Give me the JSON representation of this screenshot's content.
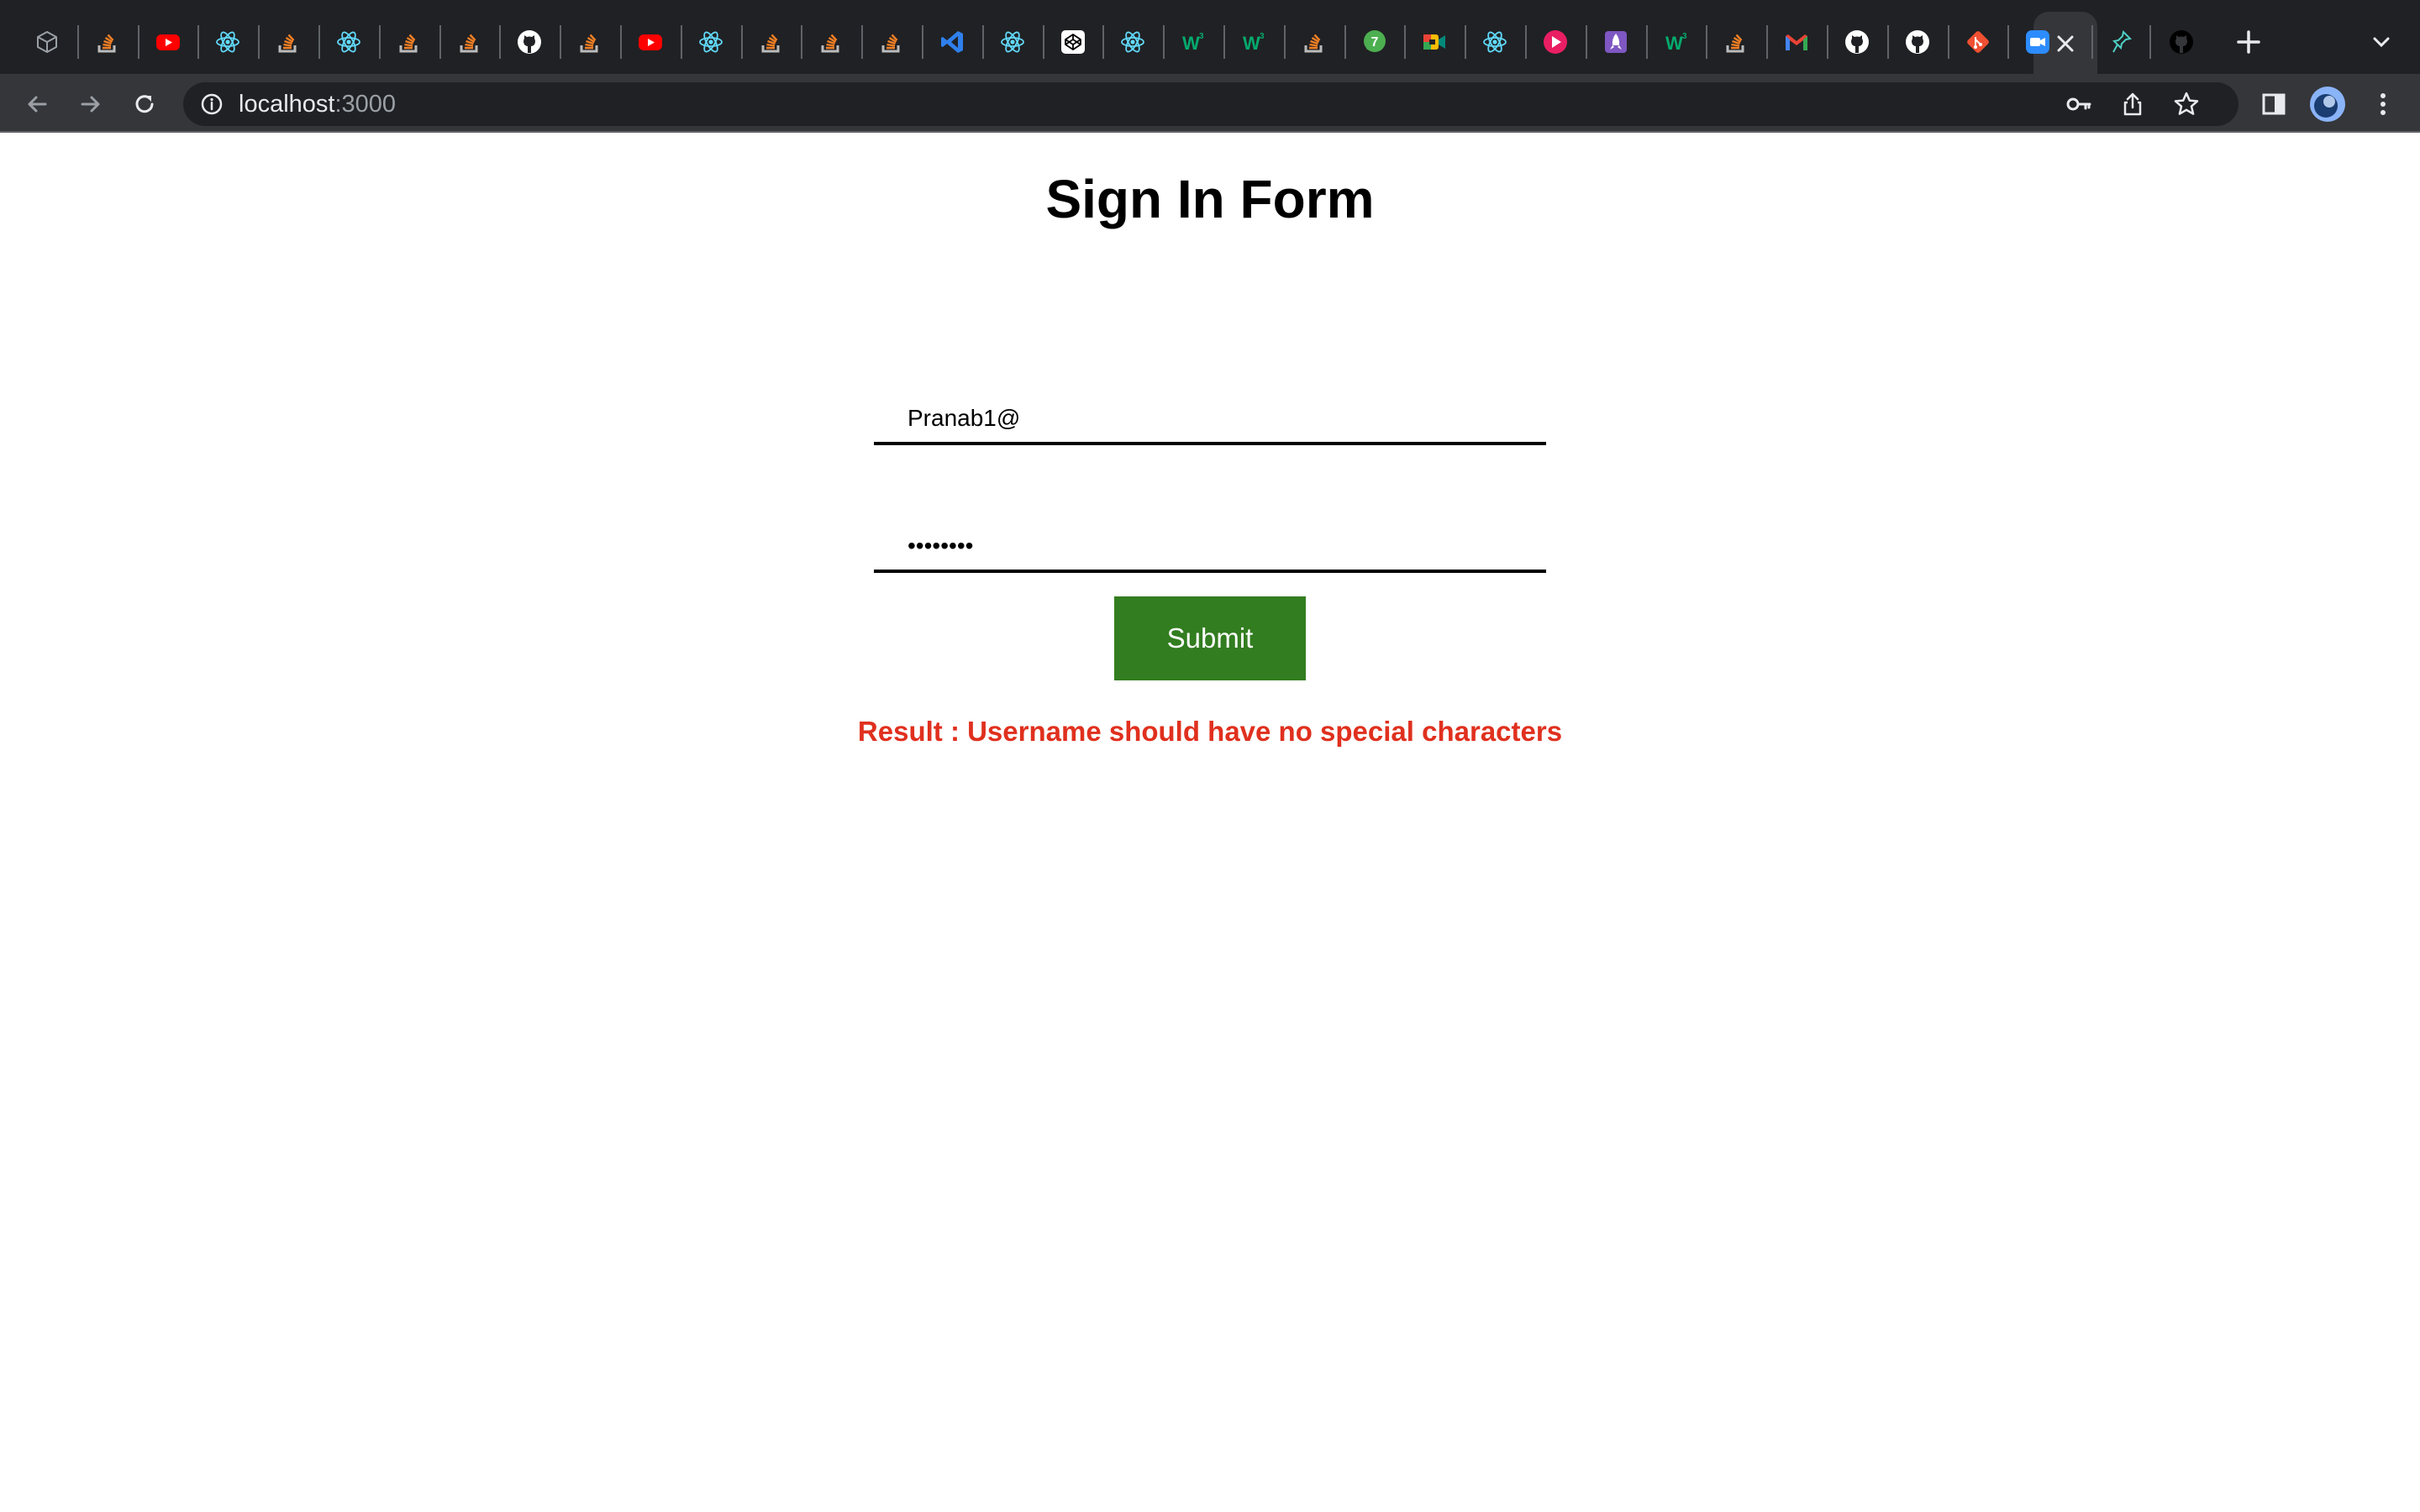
{
  "browser": {
    "tabs": [
      {
        "icon": "cube-icon",
        "color": "#9aa0a6"
      },
      {
        "icon": "stackoverflow-icon",
        "color": "#f48024"
      },
      {
        "icon": "youtube-icon",
        "color": "#ff0000"
      },
      {
        "icon": "react-icon",
        "color": "#61dafb"
      },
      {
        "icon": "stackoverflow-icon",
        "color": "#f48024"
      },
      {
        "icon": "react-icon",
        "color": "#61dafb"
      },
      {
        "icon": "stackoverflow-icon",
        "color": "#f48024"
      },
      {
        "icon": "stackoverflow-icon",
        "color": "#f48024"
      },
      {
        "icon": "github-icon",
        "color": "#ffffff"
      },
      {
        "icon": "stackoverflow-icon",
        "color": "#f48024"
      },
      {
        "icon": "youtube-icon",
        "color": "#ff0000"
      },
      {
        "icon": "react-icon",
        "color": "#61dafb"
      },
      {
        "icon": "stackoverflow-icon",
        "color": "#f48024"
      },
      {
        "icon": "stackoverflow-icon",
        "color": "#f48024"
      },
      {
        "icon": "stackoverflow-icon",
        "color": "#f48024"
      },
      {
        "icon": "vscode-icon",
        "color": "#2f80ed"
      },
      {
        "icon": "react-icon",
        "color": "#61dafb"
      },
      {
        "icon": "codepen-icon",
        "color": "#ffffff"
      },
      {
        "icon": "react-icon",
        "color": "#61dafb"
      },
      {
        "icon": "w3schools-icon",
        "color": "#04aa6d"
      },
      {
        "icon": "w3schools-icon",
        "color": "#04aa6d"
      },
      {
        "icon": "stackoverflow-icon",
        "color": "#f48024"
      },
      {
        "icon": "chat-icon",
        "color": "#4caf50"
      },
      {
        "icon": "google-meet-icon",
        "color": "#00897b"
      },
      {
        "icon": "react-icon",
        "color": "#61dafb"
      },
      {
        "icon": "play-icon",
        "color": "#e91e63"
      },
      {
        "icon": "rocket-icon",
        "color": "#7e57c2"
      },
      {
        "icon": "w3schools-icon",
        "color": "#04aa6d"
      },
      {
        "icon": "stackoverflow-icon",
        "color": "#f48024"
      },
      {
        "icon": "gmail-icon",
        "color": "#ea4335"
      },
      {
        "icon": "github-icon",
        "color": "#ffffff"
      },
      {
        "icon": "github-icon",
        "color": "#ffffff"
      },
      {
        "icon": "git-icon",
        "color": "#f05032"
      },
      {
        "icon": "zoom-icon",
        "color": "#2d8cff"
      }
    ],
    "after_tabs": [
      {
        "icon": "pin-icon",
        "color": "#4dd0c6"
      },
      {
        "icon": "github-icon",
        "color": "#000000"
      }
    ],
    "url_host": "localhost",
    "url_port": ":3000"
  },
  "page": {
    "title": "Sign In Form",
    "username_value": "Pranab1@",
    "password_value": "password",
    "submit_label": "Submit",
    "result_text": "Result : Username should have no special characters"
  },
  "colors": {
    "submit_bg": "#327d1f",
    "result_text": "#e0301e"
  }
}
